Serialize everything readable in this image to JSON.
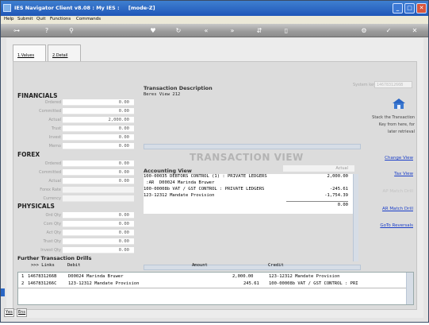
{
  "window": {
    "title": "IES Navigator Client v8.08 : My IES :     [mode-Z]",
    "controls": [
      "_",
      "□",
      "✕"
    ]
  },
  "menu": [
    "Help",
    "Submit",
    "Quit",
    "Functions",
    "Commands"
  ],
  "toolbar": {
    "icons": [
      "key-icon",
      "help-icon",
      "search-icon",
      "heart-icon",
      "refresh-icon",
      "rewind-icon",
      "fast-forward-icon",
      "stack-icon",
      "document-icon",
      "settings-icon",
      "check-icon",
      "close-icon"
    ]
  },
  "tabs": [
    {
      "label": "1.Values",
      "active": true
    },
    {
      "label": "2.Detail",
      "active": false
    }
  ],
  "financials": {
    "title": "FINANCIALS",
    "rows": [
      {
        "label": "Ordered",
        "value": "0.00"
      },
      {
        "label": "Committed",
        "value": "0.00"
      },
      {
        "label": "Actual",
        "value": "2,000.00"
      },
      {
        "label": "Trust",
        "value": "0.00"
      },
      {
        "label": "Invest",
        "value": "0.00"
      },
      {
        "label": "Memo",
        "value": "0.00"
      }
    ]
  },
  "forex": {
    "title": "FOREX",
    "rows": [
      {
        "label": "Ordered",
        "value": "0.00"
      },
      {
        "label": "Committed",
        "value": "0.00"
      },
      {
        "label": "Actual",
        "value": "0.00"
      },
      {
        "label": "Forex Rate",
        "value": ""
      },
      {
        "label": "Currency",
        "value": ""
      }
    ]
  },
  "physicals": {
    "title": "PHYSICALS",
    "rows": [
      {
        "label": "Ord Qty",
        "value": "0.00"
      },
      {
        "label": "Com Qty",
        "value": "0.00"
      },
      {
        "label": "Act Qty",
        "value": "0.00"
      },
      {
        "label": "Trust Qty",
        "value": "0.00"
      },
      {
        "label": "Invest Qty",
        "value": "0.00"
      }
    ]
  },
  "transaction": {
    "desc_label": "Transaction Description",
    "desc_value": "Beres View 212",
    "system_key_label": "System key",
    "system_key_value": "1467831266B",
    "watermark": "TRANSACTION VIEW",
    "accounting_label": "Accounting View",
    "actual_header": "Actual",
    "lines": [
      {
        "text": "100-00035 DEBTORS CONTROL (1) : PRIVATE LEDGERS",
        "amount": "2,000.00"
      },
      {
        "text": " :AR  D00024 Marinda Bruwer",
        "amount": ""
      },
      {
        "text": "100-00008b VAT / GST CONTROL : PRIVATE LEDGERS",
        "amount": "-245.61"
      },
      {
        "text": "123-12312 Mandate Provision",
        "amount": "-1,754.39"
      }
    ],
    "total": "0.00"
  },
  "right_panel": {
    "stack_text": "Stack the Transaction Key from here, for later retrieval",
    "links": [
      {
        "label": "Change View",
        "enabled": true
      },
      {
        "label": "Tax View",
        "enabled": true
      },
      {
        "label": "AP Match Drill",
        "enabled": false
      },
      {
        "label": "AR Match Drill",
        "enabled": true
      },
      {
        "label": "GoTo Reversals",
        "enabled": true
      }
    ]
  },
  "drills": {
    "title": "Further Transaction Drills",
    "headers": {
      "links": ">>> Links",
      "debit": "Debit",
      "amount": "Amount",
      "credit": "Credit"
    },
    "rows": [
      {
        "num": "1",
        "key": "1467831266B",
        "debit": "D00024 Marinda Bruwer",
        "amount": "2,000.00",
        "credit": "123-12312 Mandate Provision"
      },
      {
        "num": "2",
        "key": "1467831266C",
        "debit": "123-12312 Mandate Provision",
        "amount": "245.61",
        "credit": "100-00008b VAT / GST CONTROL : PRI"
      }
    ]
  },
  "status_buttons": [
    "Yes",
    "Ens"
  ],
  "colors": {
    "title_bar": "#2a66c4",
    "link": "#1a3ec8",
    "watermark": "#b4b4b4"
  }
}
